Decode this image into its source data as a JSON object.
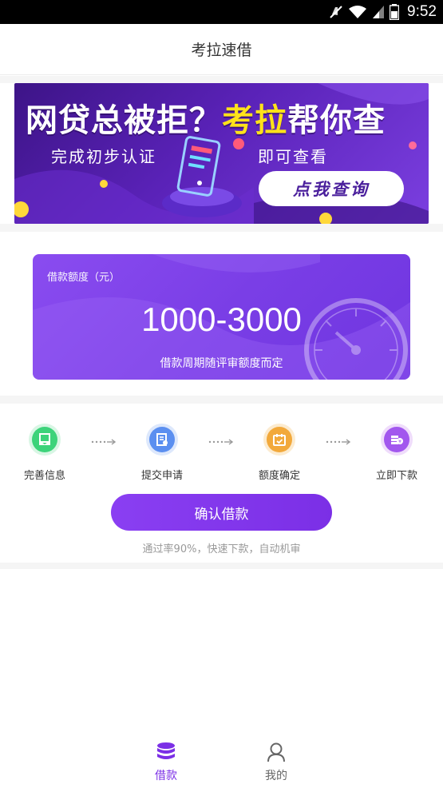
{
  "status_bar": {
    "time": "9:52"
  },
  "header": {
    "title": "考拉速借"
  },
  "banner": {
    "headline_part1": "网贷总被拒？",
    "headline_part2": "考拉",
    "headline_part3": "帮你查",
    "sub_left": "完成初步认证",
    "sub_right": "即可查看",
    "cta": "点我查询"
  },
  "quota": {
    "label": "借款额度（元）",
    "amount": "1000-3000",
    "note": "借款周期随评审额度而定"
  },
  "steps": [
    {
      "label": "完善信息",
      "icon": "document-check-icon",
      "color": "#3cd37a"
    },
    {
      "label": "提交申请",
      "icon": "submit-form-icon",
      "color": "#5b8ff0"
    },
    {
      "label": "额度确定",
      "icon": "calendar-check-icon",
      "color": "#f2a93b"
    },
    {
      "label": "立即下款",
      "icon": "money-stack-icon",
      "color": "#a257ee"
    }
  ],
  "confirm_button": "确认借款",
  "pass_note": "通过率90%，快速下款，自动机审",
  "bottom_nav": [
    {
      "label": "借款",
      "icon": "database-icon",
      "active": true
    },
    {
      "label": "我的",
      "icon": "user-icon",
      "active": false
    }
  ],
  "colors": {
    "accent": "#7b2fe6",
    "inactive": "#666666"
  }
}
